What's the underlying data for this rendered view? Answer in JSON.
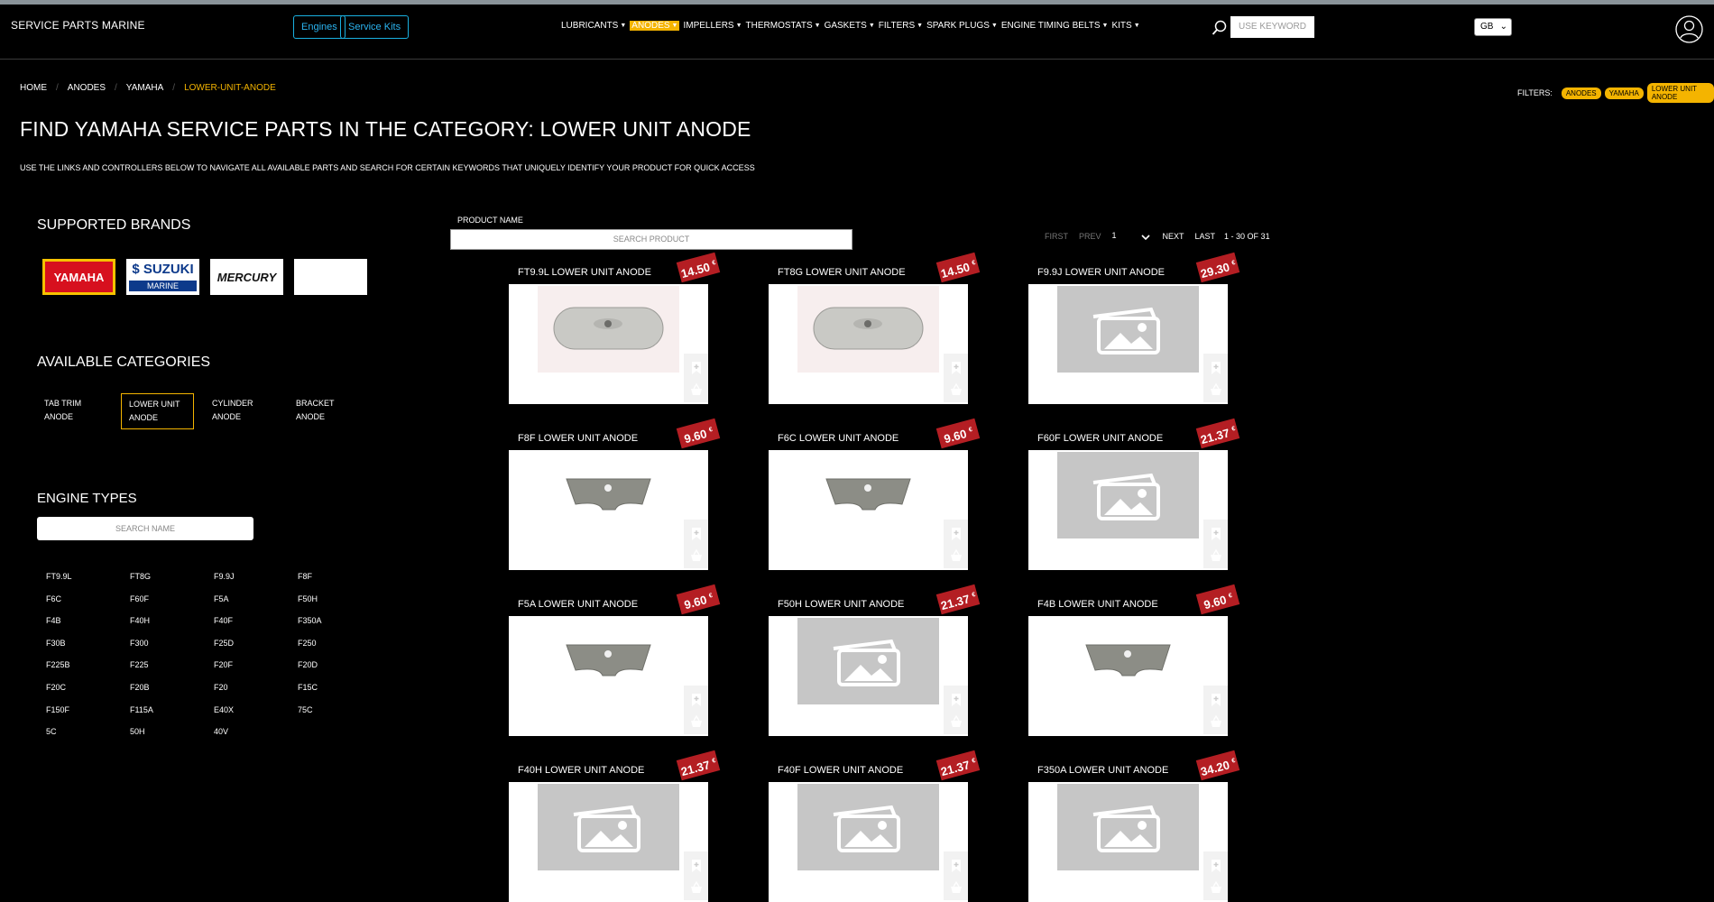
{
  "header": {
    "brand": "SERVICE PARTS MARINE",
    "pills": [
      "Engines",
      "Service Kits"
    ],
    "menu": [
      {
        "label": "LUBRICANTS",
        "active": false
      },
      {
        "label": "ANODES",
        "active": true
      },
      {
        "label": "IMPELLERS",
        "active": false
      },
      {
        "label": "THERMOSTATS",
        "active": false
      },
      {
        "label": "GASKETS",
        "active": false
      },
      {
        "label": "FILTERS",
        "active": false
      },
      {
        "label": "SPARK PLUGS",
        "active": false
      },
      {
        "label": "ENGINE TIMING BELTS",
        "active": false
      },
      {
        "label": "KITS",
        "active": false
      }
    ],
    "keyword_placeholder": "USE KEYWORD",
    "language": "GB"
  },
  "breadcrumb": [
    "HOME",
    "ANODES",
    "YAMAHA",
    "LOWER-UNIT-ANODE"
  ],
  "filters": {
    "label": "FILTERS:",
    "chips": [
      "ANODES",
      "YAMAHA",
      "LOWER UNIT ANODE"
    ]
  },
  "page": {
    "title": "FIND YAMAHA SERVICE PARTS IN THE CATEGORY: LOWER UNIT ANODE",
    "subtitle": "USE THE LINKS AND CONTROLLERS BELOW TO NAVIGATE ALL AVAILABLE PARTS AND SEARCH FOR CERTAIN KEYWORDS THAT UNIQUELY IDENTIFY YOUR PRODUCT FOR QUICK ACCESS"
  },
  "sidebar": {
    "brands_heading": "SUPPORTED BRANDS",
    "brands": [
      {
        "logo_text": "YAMAHA",
        "logo_sub": ""
      },
      {
        "logo_text": "$ SUZUKI",
        "logo_sub": "MARINE"
      },
      {
        "logo_text": "MERCURY",
        "logo_sub": ""
      },
      {
        "logo_text": "",
        "logo_sub": ""
      }
    ],
    "categories_heading": "AVAILABLE CATEGORIES",
    "categories": [
      {
        "label": "TAB TRIM ANODE",
        "selected": false
      },
      {
        "label": "LOWER UNIT ANODE",
        "selected": true
      },
      {
        "label": "CYLINDER ANODE",
        "selected": false
      },
      {
        "label": "BRACKET ANODE",
        "selected": false
      }
    ],
    "engines_heading": "ENGINE TYPES",
    "engines_search_placeholder": "SEARCH NAME",
    "engines": [
      "FT9.9L",
      "FT8G",
      "F9.9J",
      "F8F",
      "F6C",
      "F60F",
      "F5A",
      "F50H",
      "F4B",
      "F40H",
      "F40F",
      "F350A",
      "F30B",
      "F300",
      "F25D",
      "F250",
      "F225B",
      "F225",
      "F20F",
      "F20D",
      "F20C",
      "F20B",
      "F20",
      "F15C",
      "F150F",
      "F115A",
      "E40X",
      "75C",
      "5C",
      "50H",
      "40V"
    ]
  },
  "products": {
    "name_label": "PRODUCT NAME",
    "search_placeholder": "SEARCH PRODUCT",
    "pager": {
      "first": "FIRST",
      "prev": "PREV",
      "page": "1",
      "next": "NEXT",
      "last": "LAST",
      "range": "1 - 30 OF 31"
    },
    "currency": "€",
    "items": [
      {
        "name": "FT9.9L LOWER UNIT ANODE",
        "price": "14.50",
        "image": "flat-anode"
      },
      {
        "name": "FT8G LOWER UNIT ANODE",
        "price": "14.50",
        "image": "flat-anode"
      },
      {
        "name": "F9.9J LOWER UNIT ANODE",
        "price": "29.30",
        "image": "placeholder"
      },
      {
        "name": "F8F LOWER UNIT ANODE",
        "price": "9.60",
        "image": "wing-anode"
      },
      {
        "name": "F6C LOWER UNIT ANODE",
        "price": "9.60",
        "image": "wing-anode"
      },
      {
        "name": "F60F LOWER UNIT ANODE",
        "price": "21.37",
        "image": "placeholder"
      },
      {
        "name": "F5A LOWER UNIT ANODE",
        "price": "9.60",
        "image": "wing-anode"
      },
      {
        "name": "F50H LOWER UNIT ANODE",
        "price": "21.37",
        "image": "placeholder"
      },
      {
        "name": "F4B LOWER UNIT ANODE",
        "price": "9.60",
        "image": "wing-anode"
      },
      {
        "name": "F40H LOWER UNIT ANODE",
        "price": "21.37",
        "image": "placeholder"
      },
      {
        "name": "F40F LOWER UNIT ANODE",
        "price": "21.37",
        "image": "placeholder"
      },
      {
        "name": "F350A LOWER UNIT ANODE",
        "price": "34.20",
        "image": "placeholder"
      }
    ]
  },
  "colors": {
    "accent": "#f4b400",
    "price_tag": "#b41e23",
    "pill": "#2bb4f0"
  }
}
